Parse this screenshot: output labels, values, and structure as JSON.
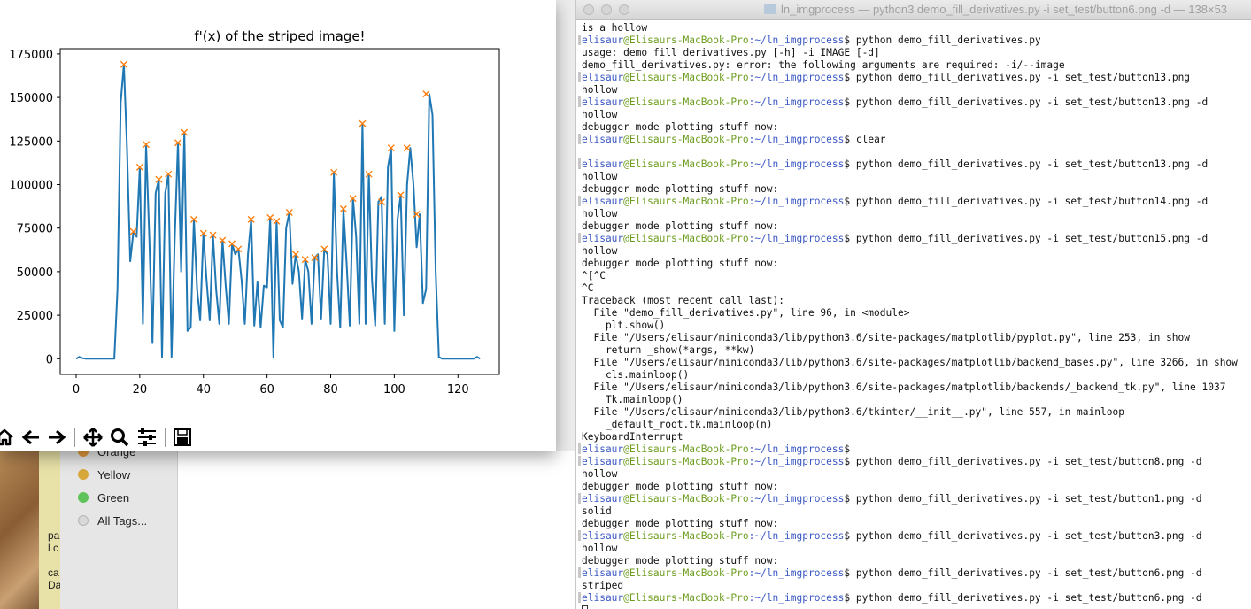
{
  "finder": {
    "tags": [
      {
        "label": "Orange",
        "color": "#e59a3b"
      },
      {
        "label": "Yellow",
        "color": "#d8a93a"
      },
      {
        "label": "Green",
        "color": "#5fc35a"
      },
      {
        "label": "All Tags...",
        "color": "#d9d9d9"
      }
    ],
    "partial_text": [
      "pa",
      "l c",
      "ca",
      "Da"
    ]
  },
  "plot_window": {
    "toolbar": [
      {
        "name": "home-icon"
      },
      {
        "name": "back-arrow-icon"
      },
      {
        "name": "forward-arrow-icon"
      },
      {
        "name": "pan-move-icon"
      },
      {
        "name": "zoom-magnifier-icon"
      },
      {
        "name": "configure-subplots-icon"
      },
      {
        "name": "save-floppy-icon"
      }
    ]
  },
  "chart_data": {
    "type": "line",
    "title": "f'(x) of the striped image!",
    "xlabel": "",
    "ylabel": "",
    "xlim": [
      -5,
      133
    ],
    "ylim": [
      -9000,
      178000
    ],
    "xticks": [
      0,
      20,
      40,
      60,
      80,
      100,
      120
    ],
    "yticks": [
      0,
      25000,
      50000,
      75000,
      100000,
      125000,
      150000,
      175000
    ],
    "line_color": "#1f77b4",
    "marker_color": "#ff7f0e",
    "grid": false,
    "series": [
      {
        "values": [
          0,
          1000,
          300,
          0,
          0,
          0,
          0,
          0,
          0,
          0,
          0,
          0,
          0,
          40000,
          147000,
          169000,
          120000,
          56000,
          73000,
          70000,
          110000,
          20000,
          123000,
          70000,
          9000,
          95000,
          103000,
          1000,
          95000,
          106000,
          1000,
          70000,
          124000,
          50000,
          130000,
          16000,
          18000,
          80000,
          40000,
          22000,
          72000,
          45000,
          22000,
          71000,
          40000,
          20000,
          68000,
          42000,
          20000,
          66000,
          60000,
          63000,
          45000,
          20000,
          60000,
          80000,
          19000,
          44000,
          18000,
          42000,
          41000,
          81000,
          1000,
          79000,
          22000,
          18000,
          75000,
          84000,
          43000,
          60000,
          50000,
          23000,
          57000,
          50000,
          20000,
          58000,
          60000,
          23000,
          63000,
          60000,
          20000,
          107000,
          50000,
          18000,
          86000,
          55000,
          19000,
          92000,
          70000,
          20000,
          135000,
          20000,
          106000,
          45000,
          19000,
          90000,
          93000,
          20000,
          110000,
          121000,
          16000,
          80000,
          94000,
          25000,
          100000,
          121000,
          100000,
          64000,
          83000,
          32000,
          40000,
          152000,
          140000,
          50000,
          1000,
          0,
          0,
          0,
          0,
          0,
          0,
          0,
          0,
          0,
          0,
          0,
          1000,
          0
        ],
        "markers": [
          {
            "x": 15,
            "y": 169000
          },
          {
            "x": 18,
            "y": 73000
          },
          {
            "x": 20,
            "y": 110000
          },
          {
            "x": 22,
            "y": 123000
          },
          {
            "x": 26,
            "y": 103000
          },
          {
            "x": 29,
            "y": 106000
          },
          {
            "x": 32,
            "y": 124000
          },
          {
            "x": 34,
            "y": 130000
          },
          {
            "x": 37,
            "y": 80000
          },
          {
            "x": 40,
            "y": 72000
          },
          {
            "x": 43,
            "y": 71000
          },
          {
            "x": 46,
            "y": 68000
          },
          {
            "x": 49,
            "y": 66000
          },
          {
            "x": 51,
            "y": 63000
          },
          {
            "x": 55,
            "y": 80000
          },
          {
            "x": 61,
            "y": 81000
          },
          {
            "x": 63,
            "y": 79000
          },
          {
            "x": 67,
            "y": 84000
          },
          {
            "x": 69,
            "y": 60000
          },
          {
            "x": 72,
            "y": 57000
          },
          {
            "x": 75,
            "y": 58000
          },
          {
            "x": 78,
            "y": 63000
          },
          {
            "x": 81,
            "y": 107000
          },
          {
            "x": 84,
            "y": 86000
          },
          {
            "x": 87,
            "y": 92000
          },
          {
            "x": 90,
            "y": 135000
          },
          {
            "x": 92,
            "y": 106000
          },
          {
            "x": 96,
            "y": 90000
          },
          {
            "x": 99,
            "y": 121000
          },
          {
            "x": 102,
            "y": 94000
          },
          {
            "x": 104,
            "y": 121000
          },
          {
            "x": 107,
            "y": 83000
          },
          {
            "x": 110,
            "y": 152000
          }
        ]
      }
    ]
  },
  "terminal": {
    "title": "ln_imgprocess — python3 demo_fill_derivatives.py -i set_test/button6.png -d — 138×53",
    "lines": [
      {
        "t": "o",
        "text": "is a hollow"
      },
      {
        "t": "p",
        "user": "elisaur",
        "host": "@Elisaurs-MacBook-Pro",
        "cwd": ":~/ln_imgprocess",
        "cmd": "$ python demo_fill_derivatives.py"
      },
      {
        "t": "o",
        "text": "usage: demo_fill_derivatives.py [-h] -i IMAGE [-d]"
      },
      {
        "t": "o",
        "text": "demo_fill_derivatives.py: error: the following arguments are required: -i/--image"
      },
      {
        "t": "p",
        "user": "elisaur",
        "host": "@Elisaurs-MacBook-Pro",
        "cwd": ":~/ln_imgprocess",
        "cmd": "$ python demo_fill_derivatives.py -i set_test/button13.png"
      },
      {
        "t": "o",
        "text": "hollow"
      },
      {
        "t": "p",
        "user": "elisaur",
        "host": "@Elisaurs-MacBook-Pro",
        "cwd": ":~/ln_imgprocess",
        "cmd": "$ python demo_fill_derivatives.py -i set_test/button13.png -d"
      },
      {
        "t": "o",
        "text": "hollow"
      },
      {
        "t": "o",
        "text": "debugger mode plotting stuff now:"
      },
      {
        "t": "p",
        "user": "elisaur",
        "host": "@Elisaurs-MacBook-Pro",
        "cwd": ":~/ln_imgprocess",
        "cmd": "$ clear"
      },
      {
        "t": "o",
        "text": ""
      },
      {
        "t": "p",
        "user": "elisaur",
        "host": "@Elisaurs-MacBook-Pro",
        "cwd": ":~/ln_imgprocess",
        "cmd": "$ python demo_fill_derivatives.py -i set_test/button13.png -d"
      },
      {
        "t": "o",
        "text": "hollow"
      },
      {
        "t": "o",
        "text": "debugger mode plotting stuff now:"
      },
      {
        "t": "p",
        "user": "elisaur",
        "host": "@Elisaurs-MacBook-Pro",
        "cwd": ":~/ln_imgprocess",
        "cmd": "$ python demo_fill_derivatives.py -i set_test/button14.png -d"
      },
      {
        "t": "o",
        "text": "hollow"
      },
      {
        "t": "o",
        "text": "debugger mode plotting stuff now:"
      },
      {
        "t": "p",
        "user": "elisaur",
        "host": "@Elisaurs-MacBook-Pro",
        "cwd": ":~/ln_imgprocess",
        "cmd": "$ python demo_fill_derivatives.py -i set_test/button15.png -d"
      },
      {
        "t": "o",
        "text": "hollow"
      },
      {
        "t": "o",
        "text": "debugger mode plotting stuff now:"
      },
      {
        "t": "o",
        "text": "^[^C"
      },
      {
        "t": "o",
        "text": "^C"
      },
      {
        "t": "o",
        "text": "Traceback (most recent call last):"
      },
      {
        "t": "o",
        "text": "  File \"demo_fill_derivatives.py\", line 96, in <module>"
      },
      {
        "t": "o",
        "text": "    plt.show()"
      },
      {
        "t": "o",
        "text": "  File \"/Users/elisaur/miniconda3/lib/python3.6/site-packages/matplotlib/pyplot.py\", line 253, in show"
      },
      {
        "t": "o",
        "text": "    return _show(*args, **kw)"
      },
      {
        "t": "o",
        "text": "  File \"/Users/elisaur/miniconda3/lib/python3.6/site-packages/matplotlib/backend_bases.py\", line 3266, in show"
      },
      {
        "t": "o",
        "text": "    cls.mainloop()"
      },
      {
        "t": "o",
        "text": "  File \"/Users/elisaur/miniconda3/lib/python3.6/site-packages/matplotlib/backends/_backend_tk.py\", line 1037"
      },
      {
        "t": "o",
        "text": "    Tk.mainloop()"
      },
      {
        "t": "o",
        "text": "  File \"/Users/elisaur/miniconda3/lib/python3.6/tkinter/__init__.py\", line 557, in mainloop"
      },
      {
        "t": "o",
        "text": "    _default_root.tk.mainloop(n)"
      },
      {
        "t": "o",
        "text": "KeyboardInterrupt"
      },
      {
        "t": "p",
        "user": "elisaur",
        "host": "@Elisaurs-MacBook-Pro",
        "cwd": ":~/ln_imgprocess",
        "cmd": "$"
      },
      {
        "t": "p",
        "user": "elisaur",
        "host": "@Elisaurs-MacBook-Pro",
        "cwd": ":~/ln_imgprocess",
        "cmd": "$ python demo_fill_derivatives.py -i set_test/button8.png -d"
      },
      {
        "t": "o",
        "text": "hollow"
      },
      {
        "t": "o",
        "text": "debugger mode plotting stuff now:"
      },
      {
        "t": "p",
        "user": "elisaur",
        "host": "@Elisaurs-MacBook-Pro",
        "cwd": ":~/ln_imgprocess",
        "cmd": "$ python demo_fill_derivatives.py -i set_test/button1.png -d"
      },
      {
        "t": "o",
        "text": "solid"
      },
      {
        "t": "o",
        "text": "debugger mode plotting stuff now:"
      },
      {
        "t": "p",
        "user": "elisaur",
        "host": "@Elisaurs-MacBook-Pro",
        "cwd": ":~/ln_imgprocess",
        "cmd": "$ python demo_fill_derivatives.py -i set_test/button3.png -d"
      },
      {
        "t": "o",
        "text": "hollow"
      },
      {
        "t": "o",
        "text": "debugger mode plotting stuff now:"
      },
      {
        "t": "p",
        "user": "elisaur",
        "host": "@Elisaurs-MacBook-Pro",
        "cwd": ":~/ln_imgprocess",
        "cmd": "$ python demo_fill_derivatives.py -i set_test/button6.png -d"
      },
      {
        "t": "o",
        "text": "striped"
      },
      {
        "t": "p",
        "user": "elisaur",
        "host": "@Elisaurs-MacBook-Pro",
        "cwd": ":~/ln_imgprocess",
        "cmd": "$ python demo_fill_derivatives.py -i set_test/button6.png -d"
      },
      {
        "t": "c",
        "text": ""
      }
    ]
  }
}
